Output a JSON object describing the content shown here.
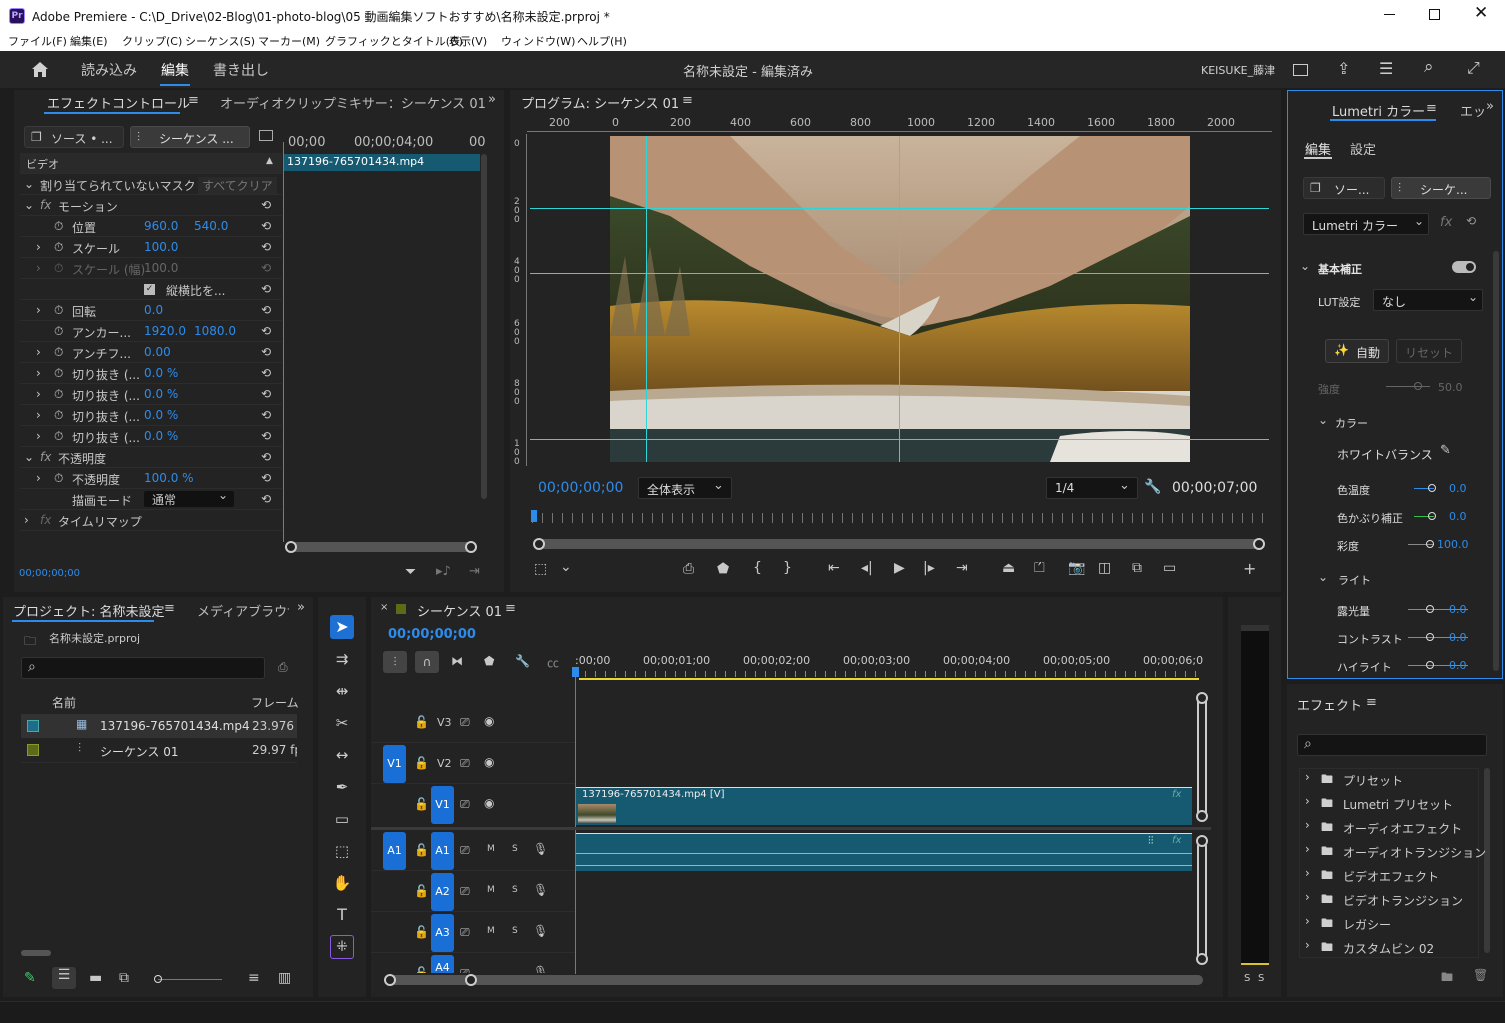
{
  "title": {
    "app_icon": "Pr",
    "text": "Adobe Premiere - C:\\D_Drive\\02-Blog\\01-photo-blog\\05 動画編集ソフトおすすめ\\名称未設定.prproj *"
  },
  "menu": [
    "ファイル(F)",
    "編集(E)",
    "クリップ(C)",
    "シーケンス(S)",
    "マーカー(M)",
    "グラフィックとタイトル(G)",
    "表示(V)",
    "ウィンドウ(W)",
    "ヘルプ(H)"
  ],
  "workspace": {
    "tabs": [
      "読み込み",
      "編集",
      "書き出し"
    ],
    "active": "編集",
    "doc_title": "名称未設定 - 編集済み",
    "user": "KEISUKE_藤津"
  },
  "effect_controls": {
    "tab": "エフェクトコントロール",
    "tab2": "オーディオクリップミキサー：シーケンス 01",
    "source_label": "ソース • ...",
    "seq_label": "シーケンス ...",
    "ruler": [
      "00;00",
      "00;00;04;00",
      "00"
    ],
    "clip": "137196-765701434.mp4",
    "video": "ビデオ",
    "unassigned": "割り当てられていないマスク",
    "clear_all": "すべてクリア",
    "motion": "モーション",
    "params": [
      {
        "name": "位置",
        "v1": "960.0",
        "v2": "540.0"
      },
      {
        "name": "スケール",
        "v1": "100.0",
        "v2": ""
      },
      {
        "name": "スケール (幅)",
        "v1": "100.0",
        "v2": ""
      },
      {
        "name": "縦横比を...",
        "v1": "",
        "v2": ""
      },
      {
        "name": "回転",
        "v1": "0.0",
        "v2": ""
      },
      {
        "name": "アンカー...",
        "v1": "1920.0",
        "v2": "1080.0"
      },
      {
        "name": "アンチフ...",
        "v1": "0.00",
        "v2": ""
      },
      {
        "name": "切り抜き (...",
        "v1": "0.0 %",
        "v2": ""
      },
      {
        "name": "切り抜き (...",
        "v1": "0.0 %",
        "v2": ""
      },
      {
        "name": "切り抜き (...",
        "v1": "0.0 %",
        "v2": ""
      },
      {
        "name": "切り抜き (...",
        "v1": "0.0 %",
        "v2": ""
      }
    ],
    "opacity": "不透明度",
    "opacity_label": "不透明度",
    "opacity_val": "100.0 %",
    "blend_label": "描画モード",
    "blend_val": "通常",
    "timeremap": "タイムリマップ",
    "timecode": "00;00;00;00"
  },
  "program": {
    "tab": "プログラム: シーケンス 01",
    "ruler": [
      "200",
      "0",
      "200",
      "400",
      "600",
      "800",
      "1000",
      "1200",
      "1400",
      "1600",
      "1800",
      "2000"
    ],
    "vruler": [
      "0",
      "2\n0\n0",
      "4\n0\n0",
      "6\n0\n0",
      "8\n0\n0",
      "1\n0\n0"
    ],
    "timecode": "00;00;00;00",
    "fit": "全体表示",
    "quality": "1/4",
    "duration": "00;00;07;00"
  },
  "lumetri": {
    "tab": "Lumetri カラー",
    "tab2": "エッ",
    "sub_tabs": [
      "編集",
      "設定"
    ],
    "source": "ソー...",
    "seq": "シーケ...",
    "dropdown": "Lumetri カラー",
    "basic": "基本補正",
    "lut_label": "LUT設定",
    "lut_val": "なし",
    "auto": "自動",
    "reset": "リセット",
    "intensity_label": "強度",
    "intensity_val": "50.0",
    "color": "カラー",
    "wb": "ホワイトバランス",
    "temp_label": "色温度",
    "temp_val": "0.0",
    "tint_label": "色かぶり補正",
    "tint_val": "0.0",
    "sat_label": "彩度",
    "sat_val": "100.0",
    "light": "ライト",
    "exp_label": "露光量",
    "exp_val": "0.0",
    "con_label": "コントラスト",
    "con_val": "0.0",
    "hi_label": "ハイライト",
    "hi_val": "0.0"
  },
  "project": {
    "tab": "プロジェクト: 名称未設定",
    "tab2": "メディアブラウザ",
    "file": "名称未設定.prproj",
    "col_name": "名前",
    "col_fps": "フレーム",
    "items": [
      {
        "name": "137196-765701434.mp4",
        "fps": "23.976 f",
        "color": "#1f6b8a"
      },
      {
        "name": "シーケンス 01",
        "fps": "29.97 fp",
        "color": "#5b6b1a"
      }
    ]
  },
  "timeline": {
    "tab": "シーケンス 01",
    "timecode": "00;00;00;00",
    "ruler": [
      ":00;00",
      "00;00;01;00",
      "00;00;02;00",
      "00;00;03;00",
      "00;00;04;00",
      "00;00;05;00",
      "00;00;06;0"
    ],
    "video_tracks": [
      "V3",
      "V2",
      "V1"
    ],
    "audio_tracks": [
      "A1",
      "A2",
      "A3",
      "A4"
    ],
    "src_v": "V1",
    "src_a": "A1",
    "clip_label": "137196-765701434.mp4 [V]",
    "m": "M",
    "s": "S"
  },
  "effects": {
    "tab": "エフェクト",
    "folders": [
      "プリセット",
      "Lumetri プリセット",
      "オーディオエフェクト",
      "オーディオトランジション",
      "ビデオエフェクト",
      "ビデオトランジション",
      "レガシー",
      "カスタムビン 02"
    ]
  },
  "meter": {
    "s1": "S",
    "s2": "S"
  }
}
